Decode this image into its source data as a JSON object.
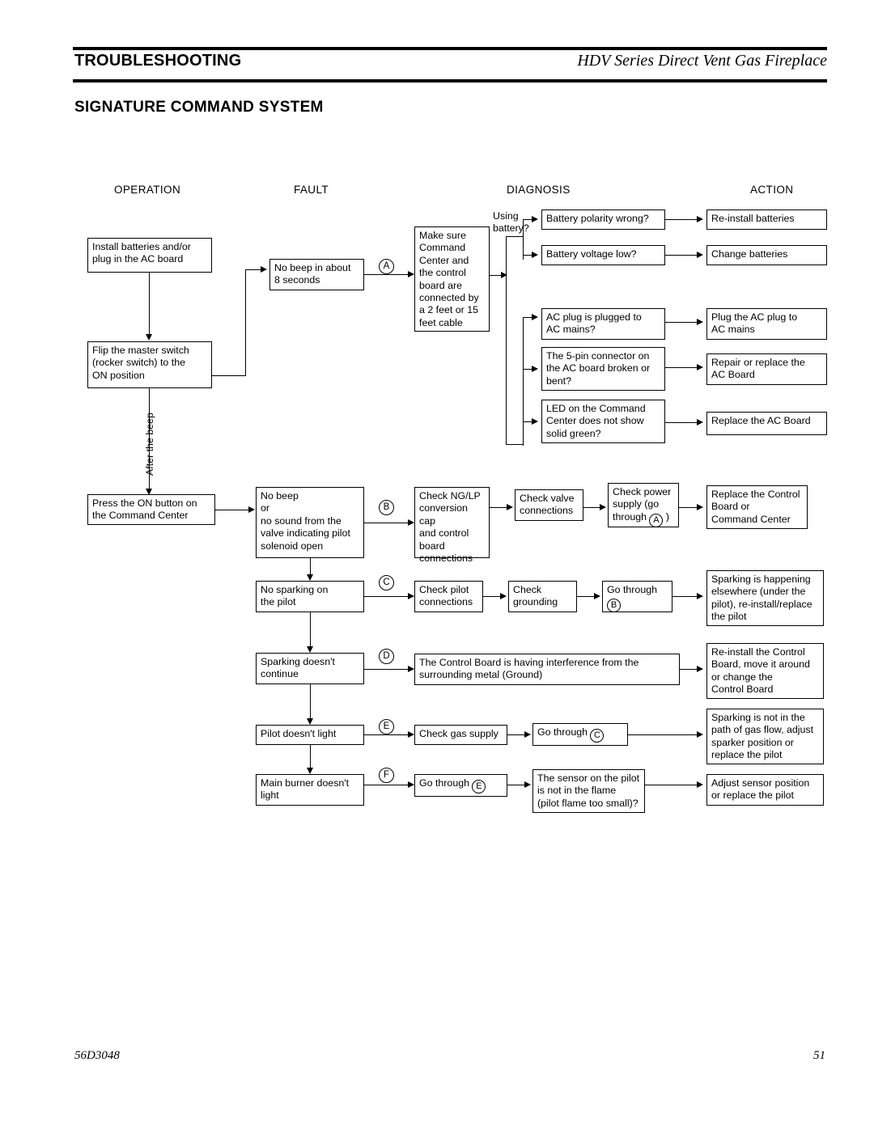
{
  "header": {
    "title": "TROUBLESHOOTING",
    "product": "HDV Series Direct Vent Gas Fireplace",
    "section_title": "SIGNATURE COMMAND SYSTEM"
  },
  "columns": [
    {
      "label": "OPERATION"
    },
    {
      "label": "FAULT"
    },
    {
      "label": "DIAGNOSIS"
    },
    {
      "label": "ACTION"
    }
  ],
  "operation": {
    "install": "Install batteries and/or\nplug in the AC board",
    "flip": "Flip the master switch\n(rocker switch) to the\nON position",
    "press_on": "Press the ON button on\nthe Command Center",
    "after_beep": "After the beep"
  },
  "faults": {
    "no_beep_8s": "No beep in about\n8 seconds",
    "no_beep_or_sound": "No beep\nor\nno sound from the\nvalve indicating pilot\nsolenoid open",
    "no_sparking": "No sparking on\nthe pilot",
    "sparking_stops": "Sparking doesn't\ncontinue",
    "pilot_no_light": "Pilot doesn't light",
    "burner_no_light": "Main burner doesn't\nlight"
  },
  "markers": {
    "a": "A",
    "b": "B",
    "c": "C",
    "d": "D",
    "e": "E",
    "f": "F"
  },
  "diagnosis": {
    "make_sure_cable": "Make sure\nCommand\nCenter and\nthe control\nboard are\nconnected by\na 2 feet or 15\nfeet cable",
    "using_battery": "Using\nbattery?",
    "battery_polarity": "Battery polarity wrong?",
    "battery_voltage": "Battery voltage low?",
    "ac_plug": "AC plug is plugged to\nAC mains?",
    "five_pin": "The 5-pin connector on\nthe AC board broken or\nbent?",
    "led_green": "LED on the Command\nCenter does not show\nsolid green?",
    "check_ngl_p": "Check NG/LP\nconversion cap\nand control\nboard\nconnections",
    "check_valve": "Check valve\nconnections",
    "check_power_pre": "Check power\nsupply (go\nthrough ",
    "check_power_post": " )",
    "check_pilot_conn": "Check pilot\nconnections",
    "check_grounding": "Check\ngrounding",
    "go_through_b_pre": "Go through",
    "control_board_interference": "The Control Board is having interference from the\nsurrounding metal (Ground)",
    "check_gas_supply": "Check gas supply",
    "go_through_c_pre": "Go through ",
    "go_through_e_pre": "Go through ",
    "sensor_pilot": "The sensor on the pilot\nis not in the flame\n(pilot flame too small)?"
  },
  "actions": {
    "reinstall_batteries": "Re-install batteries",
    "change_batteries": "Change batteries",
    "plug_ac": "Plug the AC plug to\nAC mains",
    "repair_ac_board": "Repair or replace the\nAC Board",
    "replace_ac_board": "Replace the AC Board",
    "replace_control_board": "Replace the Control\nBoard or\nCommand Center",
    "sparking_elsewhere": "Sparking is happening\nelsewhere (under the\npilot), re-install/replace\nthe pilot",
    "reinstall_control_board": "Re-install the Control\nBoard, move it around\nor change the\nControl Board",
    "sparking_not_path": "Sparking is not in the\npath of gas flow, adjust\nsparker position or\nreplace the pilot",
    "adjust_sensor": "Adjust sensor position\nor replace the pilot"
  },
  "footer": {
    "doc_number": "56D3048",
    "page_number": "51"
  }
}
